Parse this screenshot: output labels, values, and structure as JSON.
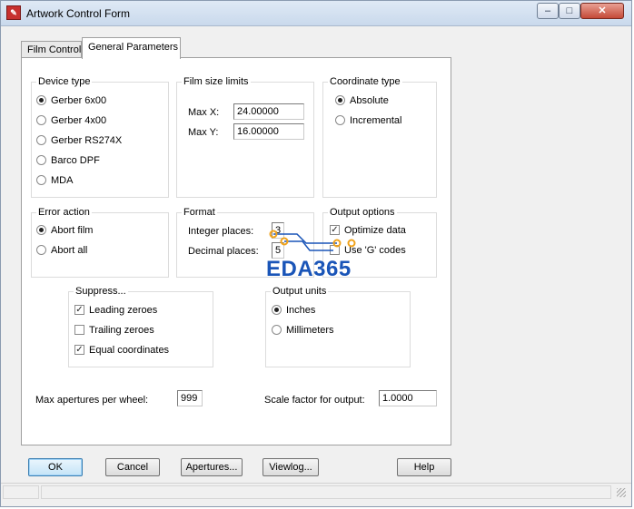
{
  "window": {
    "title": "Artwork Control Form",
    "controls": {
      "minimize": "–",
      "maximize": "□",
      "close": "✕"
    }
  },
  "tabs": [
    {
      "label": "Film Control",
      "active": false
    },
    {
      "label": "General Parameters",
      "active": true
    }
  ],
  "device_type": {
    "title": "Device type",
    "options": [
      {
        "label": "Gerber 6x00",
        "selected": true
      },
      {
        "label": "Gerber 4x00",
        "selected": false
      },
      {
        "label": "Gerber RS274X",
        "selected": false
      },
      {
        "label": "Barco DPF",
        "selected": false
      },
      {
        "label": "MDA",
        "selected": false
      }
    ]
  },
  "film_size": {
    "title": "Film size limits",
    "max_x_label": "Max X:",
    "max_x": "24.00000",
    "max_y_label": "Max Y:",
    "max_y": "16.00000"
  },
  "coordinate_type": {
    "title": "Coordinate type",
    "options": [
      {
        "label": "Absolute",
        "selected": true
      },
      {
        "label": "Incremental",
        "selected": false
      }
    ]
  },
  "error_action": {
    "title": "Error action",
    "options": [
      {
        "label": "Abort film",
        "selected": true
      },
      {
        "label": "Abort all",
        "selected": false
      }
    ]
  },
  "format": {
    "title": "Format",
    "integer_label": "Integer places:",
    "integer_value": "3",
    "decimal_label": "Decimal places:",
    "decimal_value": "5"
  },
  "output_options": {
    "title": "Output options",
    "items": [
      {
        "label": "Optimize data",
        "checked": true
      },
      {
        "label": "Use 'G' codes",
        "checked": false
      }
    ]
  },
  "suppress": {
    "title": "Suppress...",
    "items": [
      {
        "label": "Leading zeroes",
        "checked": true
      },
      {
        "label": "Trailing zeroes",
        "checked": false
      },
      {
        "label": "Equal coordinates",
        "checked": true
      }
    ]
  },
  "output_units": {
    "title": "Output units",
    "options": [
      {
        "label": "Inches",
        "selected": true
      },
      {
        "label": "Millimeters",
        "selected": false
      }
    ]
  },
  "max_apertures": {
    "label": "Max apertures per wheel:",
    "value": "999"
  },
  "scale_factor": {
    "label": "Scale factor for output:",
    "value": "1.0000"
  },
  "buttons": {
    "ok": "OK",
    "cancel": "Cancel",
    "apertures": "Apertures...",
    "viewlog": "Viewlog...",
    "help": "Help"
  },
  "watermark": {
    "text": "EDA365"
  }
}
